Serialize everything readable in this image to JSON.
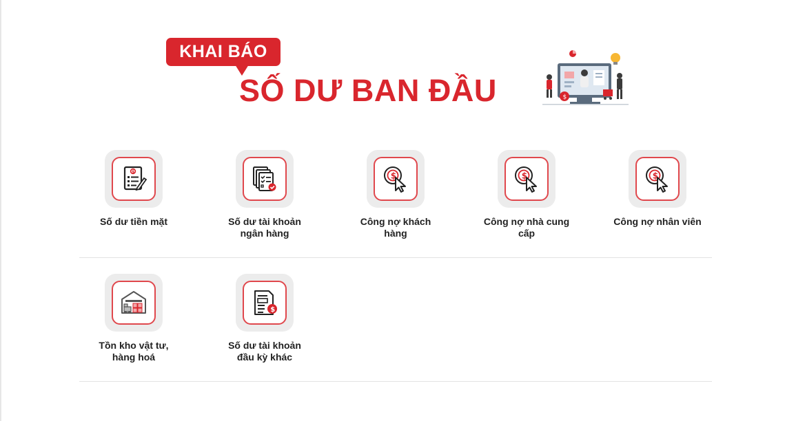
{
  "banner": {
    "badge": "KHAI BÁO",
    "title": "SỐ DƯ BAN ĐẦU"
  },
  "tiles": [
    {
      "label": "Số dư tiền mặt",
      "icon": "cash-document-icon"
    },
    {
      "label": "Số dư tài khoản ngân hàng",
      "icon": "bank-documents-icon"
    },
    {
      "label": "Công nợ khách hàng",
      "icon": "coin-cursor-icon"
    },
    {
      "label": "Công nợ nhà cung cấp",
      "icon": "coin-cursor-icon"
    },
    {
      "label": "Công nợ nhân viên",
      "icon": "coin-cursor-icon"
    },
    {
      "label": "Tồn kho vật tư, hàng hoá",
      "icon": "warehouse-icon"
    },
    {
      "label": "Số dư tài khoản đầu kỳ khác",
      "icon": "invoice-dollar-icon"
    }
  ],
  "colors": {
    "accent": "#d9262d",
    "icon_border": "#e0474c",
    "tile_bg": "#ececec"
  }
}
